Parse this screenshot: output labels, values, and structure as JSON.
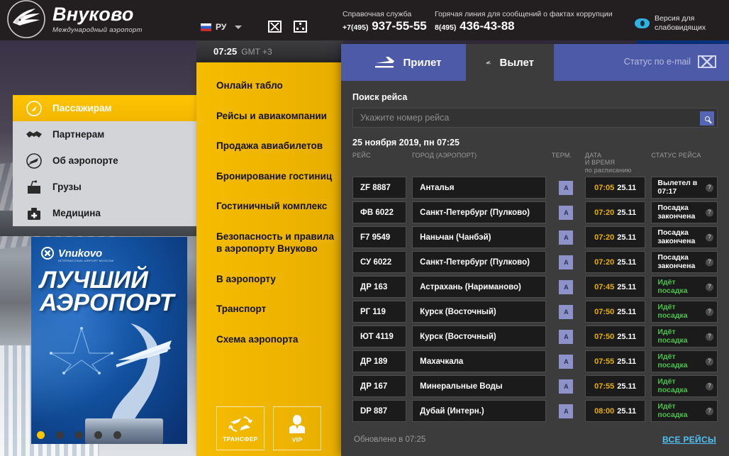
{
  "header": {
    "logo_title": "Внуково",
    "logo_subtitle": "Международный аэропорт",
    "logo_icon": "vnukovo-bird-logo",
    "language": {
      "label": "РУ",
      "flag_icon": "russia-flag-icon",
      "caret_icon": "chevron-down-icon"
    },
    "icons": [
      {
        "name": "picture-icon",
        "label": ""
      },
      {
        "name": "sitemap-icon",
        "label": ""
      }
    ],
    "contacts": [
      {
        "label": "Справочная служба",
        "prefix": "+7(495)",
        "number": "937-55-55"
      },
      {
        "label": "Горячая линия для сообщений о фактах коррупции",
        "prefix": "8(495)",
        "number": "436-43-88"
      }
    ],
    "low_vision": {
      "line1": "Версия для",
      "line2": "слабовидящих",
      "icon": "eye-icon"
    }
  },
  "clock": {
    "time": "07:25",
    "gmt": "GMT +3"
  },
  "sidebar": {
    "items": [
      {
        "label": "Пассажирам",
        "icon": "compass-icon",
        "active": true
      },
      {
        "label": "Партнерам",
        "icon": "handshake-icon",
        "active": false
      },
      {
        "label": "Об аэропорте",
        "icon": "plane-circle-icon",
        "active": false
      },
      {
        "label": "Грузы",
        "icon": "cargo-bag-icon",
        "active": false
      },
      {
        "label": "Медицина",
        "icon": "medical-case-icon",
        "active": false
      }
    ]
  },
  "banner": {
    "brand": "Vnukovo",
    "brand_sub": "INTERNATIONAL AIRPORT MOSCOW",
    "line1": "ЛУЧШИЙ",
    "line2": "АЭРОПОРТ",
    "dots": 5,
    "active_dot": 0
  },
  "yellow_menu": {
    "items": [
      "Онлайн табло",
      "Рейсы и авиакомпании",
      "Продажа авиабилетов",
      "Бронирование гостиниц",
      "Гостиничный комплекс",
      "Безопасность и правила в аэропорту Внуково",
      "В аэропорту",
      "Транспорт",
      "Схема аэропорта"
    ],
    "buttons": [
      {
        "label": "ТРАНСФЕР",
        "icon": "transfer-planes-icon"
      },
      {
        "label": "VIP",
        "icon": "vip-person-icon"
      }
    ]
  },
  "board": {
    "tabs": [
      {
        "label": "Прилет",
        "icon": "plane-arrival-icon",
        "active": false
      },
      {
        "label": "Вылет",
        "icon": "plane-departure-icon",
        "active": true
      }
    ],
    "email_status": {
      "label": "Статус по e-mail",
      "icon": "envelope-icon"
    },
    "search": {
      "label": "Поиск рейса",
      "placeholder": "Укажите номер рейса",
      "value": "",
      "button_icon": "search-icon"
    },
    "date_heading": "25 ноября 2019, пн 07:25",
    "columns": {
      "flight": "РЕЙС",
      "city": "ГОРОД (АЭРОПОРТ)",
      "terminal": "ТЕРМ.",
      "time_line1": "ДАТА",
      "time_line2": "И ВРЕМЯ",
      "time_line3": "по расписанию",
      "status": "СТАТУС РЕЙСА"
    },
    "rows": [
      {
        "flight": "ZF 8887",
        "city": "Анталья",
        "terminal": "A",
        "time": "07:05",
        "date": "25.11",
        "status": "Вылетел в 07:17",
        "status_green": false
      },
      {
        "flight": "ФВ 6022",
        "city": "Санкт-Петербург (Пулково)",
        "terminal": "A",
        "time": "07:20",
        "date": "25.11",
        "status": "Посадка закончена",
        "status_green": false
      },
      {
        "flight": "F7 9549",
        "city": "Наньчан (Чанбэй)",
        "terminal": "A",
        "time": "07:20",
        "date": "25.11",
        "status": "Посадка закончена",
        "status_green": false
      },
      {
        "flight": "СУ 6022",
        "city": "Санкт-Петербург (Пулково)",
        "terminal": "A",
        "time": "07:20",
        "date": "25.11",
        "status": "Посадка закончена",
        "status_green": false
      },
      {
        "flight": "ДР 163",
        "city": "Астрахань (Нариманово)",
        "terminal": "A",
        "time": "07:45",
        "date": "25.11",
        "status": "Идёт посадка",
        "status_green": true
      },
      {
        "flight": "РГ 119",
        "city": "Курск (Восточный)",
        "terminal": "A",
        "time": "07:50",
        "date": "25.11",
        "status": "Идёт посадка",
        "status_green": true
      },
      {
        "flight": "ЮТ 4119",
        "city": "Курск (Восточный)",
        "terminal": "A",
        "time": "07:50",
        "date": "25.11",
        "status": "Идёт посадка",
        "status_green": true
      },
      {
        "flight": "ДР 189",
        "city": "Махачкала",
        "terminal": "A",
        "time": "07:55",
        "date": "25.11",
        "status": "Идёт посадка",
        "status_green": true
      },
      {
        "flight": "ДР 167",
        "city": "Минеральные Воды",
        "terminal": "A",
        "time": "07:55",
        "date": "25.11",
        "status": "Идёт посадка",
        "status_green": true
      },
      {
        "flight": "DP 887",
        "city": "Дубай (Интерн.)",
        "terminal": "A",
        "time": "08:00",
        "date": "25.11",
        "status": "Идёт посадка",
        "status_green": true
      }
    ],
    "footer": {
      "updated": "Обновлено в 07:25",
      "all_flights": "ВСЕ РЕЙСЫ"
    }
  },
  "colors": {
    "brand_yellow": "#f5bc00",
    "tab_blue": "#4d5aa8",
    "accent_link": "#4fc3f7",
    "status_green": "#4bc24b",
    "time_amber": "#e8b000"
  }
}
